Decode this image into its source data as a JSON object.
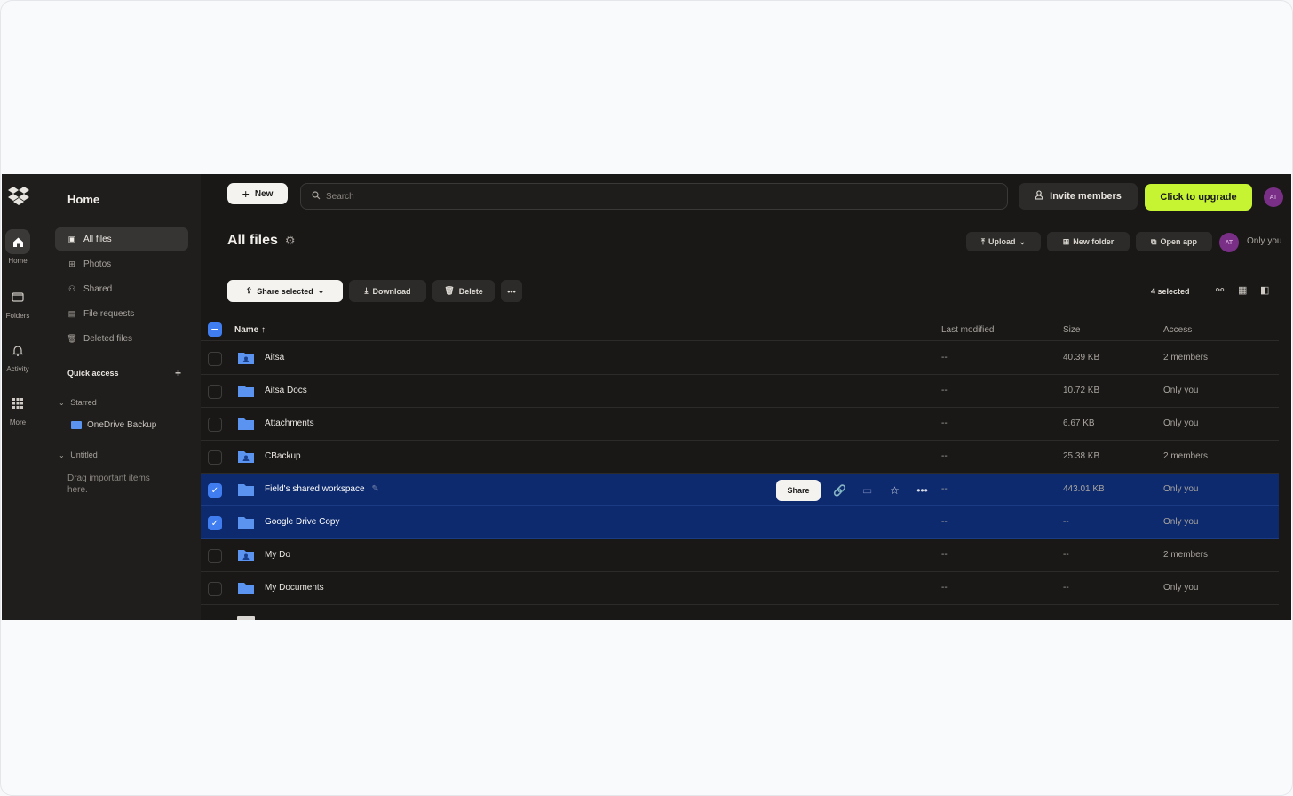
{
  "colors": {
    "accent_blue": "#3f7df0",
    "selected_row": "#0d2a6e",
    "upgrade_green": "#c6f432",
    "folder_blue": "#5b93f0",
    "avatar_purple": "#7a2f86"
  },
  "rail": {
    "items": [
      {
        "label": "Home",
        "icon": "home-icon"
      },
      {
        "label": "Folders",
        "icon": "folders-icon"
      },
      {
        "label": "Activity",
        "icon": "bell-icon"
      },
      {
        "label": "More",
        "icon": "grid-icon"
      }
    ]
  },
  "sidebar": {
    "title": "Home",
    "nav": [
      {
        "label": "All files",
        "icon": "all-files-icon"
      },
      {
        "label": "Photos",
        "icon": "photos-icon"
      },
      {
        "label": "Shared",
        "icon": "shared-icon"
      },
      {
        "label": "File requests",
        "icon": "file-requests-icon"
      },
      {
        "label": "Deleted files",
        "icon": "trash-icon"
      }
    ],
    "quick_access": "Quick access",
    "starred": "Starred",
    "starred_item": "OneDrive Backup",
    "untitled": "Untitled",
    "drag_hint": "Drag important items here."
  },
  "topbar": {
    "new_label": "New",
    "search_placeholder": "Search",
    "invite_label": "Invite members",
    "upgrade_label": "Click to upgrade",
    "avatar_initials": "AT"
  },
  "page": {
    "title": "All files",
    "upload_label": "Upload",
    "new_folder_label": "New folder",
    "open_app_label": "Open app",
    "access_label": "Only you"
  },
  "actions": {
    "share_selected": "Share selected",
    "download": "Download",
    "delete": "Delete",
    "selected_count": "4 selected"
  },
  "table": {
    "headers": {
      "name": "Name",
      "modified": "Last modified",
      "size": "Size",
      "access": "Access"
    },
    "rows": [
      {
        "name": "Aitsa",
        "modified": "--",
        "size": "40.39 KB",
        "access": "2 members",
        "shared": true,
        "selected": false
      },
      {
        "name": "Aitsa Docs",
        "modified": "--",
        "size": "10.72 KB",
        "access": "Only you",
        "shared": false,
        "selected": false
      },
      {
        "name": "Attachments",
        "modified": "--",
        "size": "6.67 KB",
        "access": "Only you",
        "shared": false,
        "selected": false
      },
      {
        "name": "CBackup",
        "modified": "--",
        "size": "25.38 KB",
        "access": "2 members",
        "shared": true,
        "selected": false
      },
      {
        "name": "Field's shared workspace",
        "modified": "--",
        "size": "443.01 KB",
        "access": "Only you",
        "shared": false,
        "selected": true
      },
      {
        "name": "Google Drive Copy",
        "modified": "--",
        "size": "--",
        "access": "Only you",
        "shared": false,
        "selected": true
      },
      {
        "name": "My Do",
        "modified": "--",
        "size": "--",
        "access": "2 members",
        "shared": true,
        "selected": false
      },
      {
        "name": "My Documents",
        "modified": "--",
        "size": "--",
        "access": "Only you",
        "shared": false,
        "selected": false
      }
    ],
    "row_share_label": "Share"
  }
}
